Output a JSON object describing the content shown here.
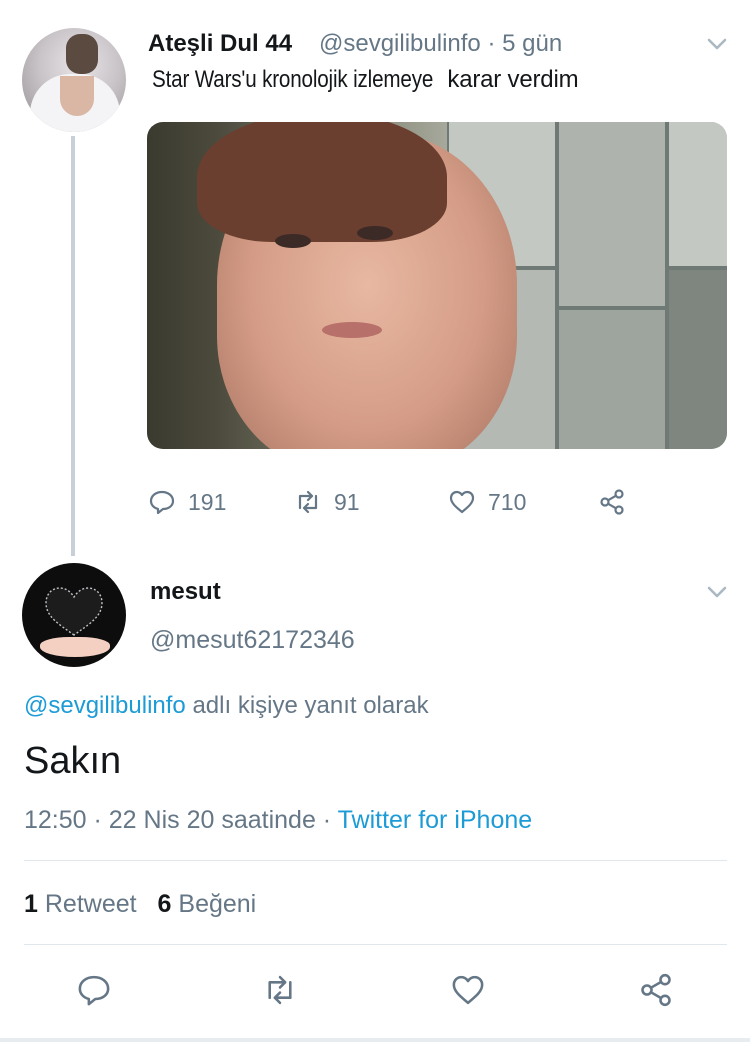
{
  "tweet": {
    "author_name": "Ateşli Dul 44",
    "handle": "@sevgilibulinfo",
    "time": "5 gün",
    "separator": "·",
    "text_part1": "Star Wars'u kronolojik izlemeye",
    "text_part2": "karar verdim",
    "reply_count": "191",
    "retweet_count": "91",
    "like_count": "710"
  },
  "reply": {
    "author_name": "mesut",
    "handle": "@mesut62172346",
    "replying_mention": "@sevgilibulinfo",
    "replying_suffix": "adlı kişiye yanıt olarak",
    "text": "Sakın",
    "time_date": "12:50 · 22 Nis 20 saatinde ·",
    "source": "Twitter for iPhone",
    "retweets_count": "1",
    "retweets_label": "Retweet",
    "likes_count": "6",
    "likes_label": "Beğeni"
  },
  "colors": {
    "link": "#1d9bd6",
    "secondary_text": "#657786",
    "primary_text": "#14171a",
    "thread_line": "#c7d0d8"
  },
  "icons": [
    "chevron-down-icon",
    "reply-icon",
    "retweet-icon",
    "like-icon",
    "share-icon"
  ]
}
